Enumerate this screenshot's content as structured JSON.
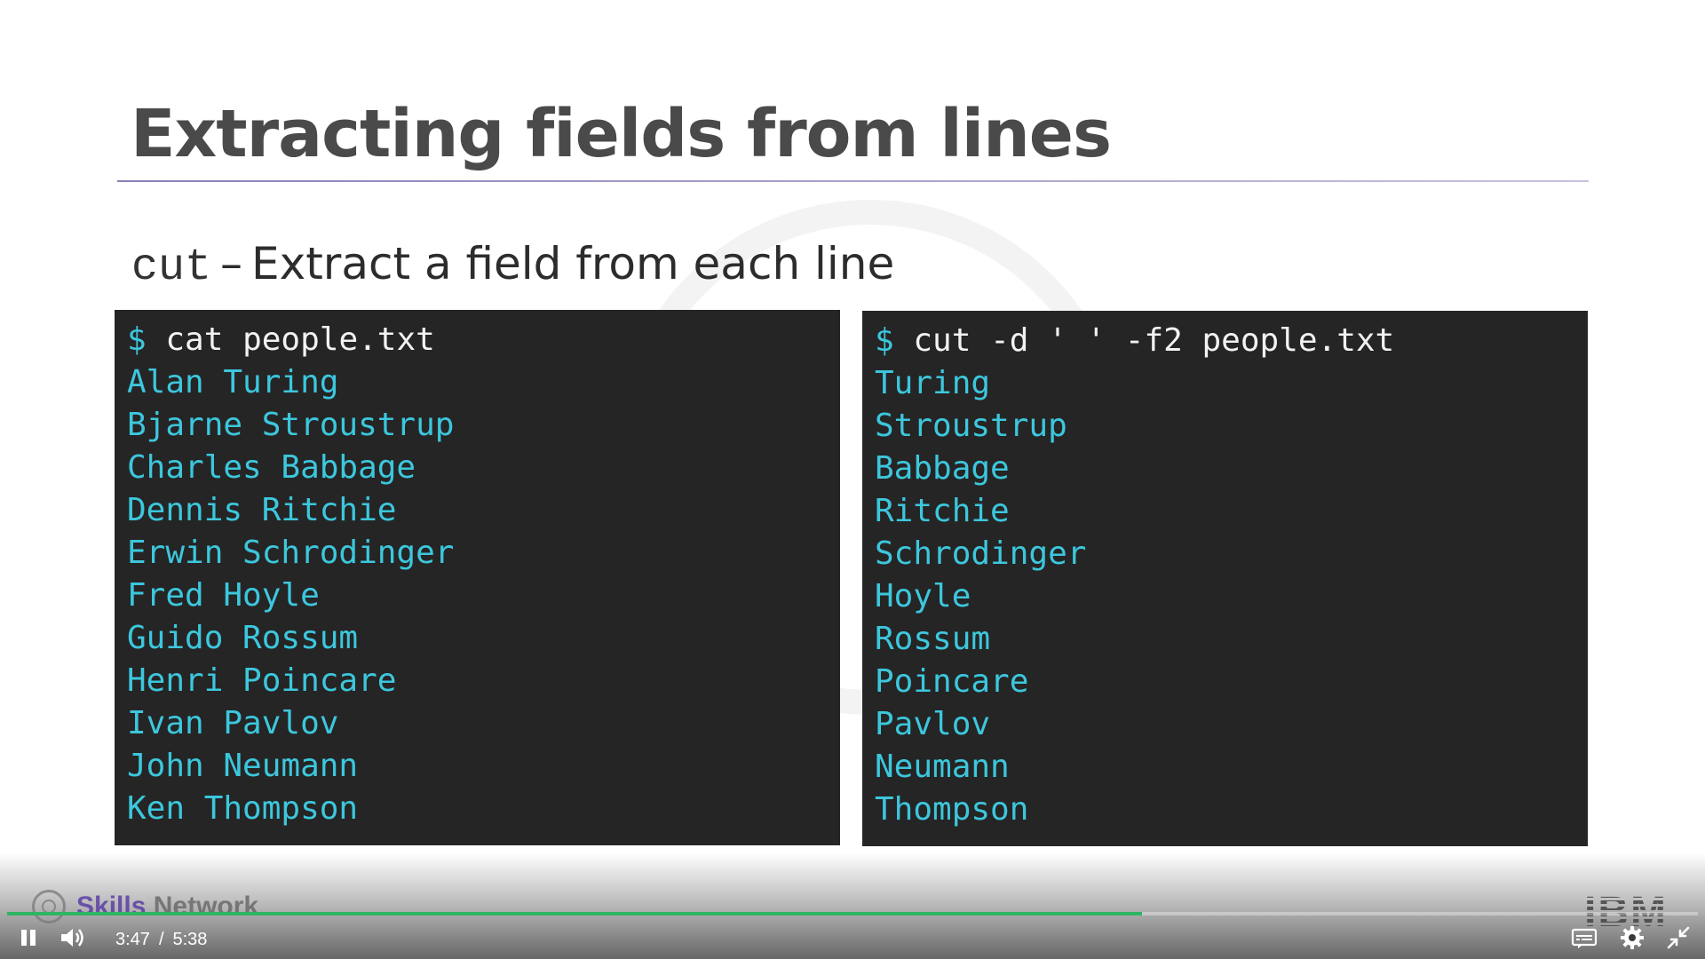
{
  "slide": {
    "title": "Extracting fields from lines",
    "subtitle_command": "cut",
    "subtitle_dash": "–",
    "subtitle_text": "Extract a field from each line"
  },
  "terminal_left": {
    "prompt_symbol": "$",
    "command": "cat people.txt",
    "lines": [
      "Alan Turing",
      "Bjarne Stroustrup",
      "Charles Babbage",
      "Dennis Ritchie",
      "Erwin Schrodinger",
      "Fred Hoyle",
      "Guido Rossum",
      "Henri Poincare",
      "Ivan Pavlov",
      "John Neumann",
      "Ken Thompson"
    ]
  },
  "terminal_right": {
    "prompt_symbol": "$",
    "command": "cut -d ' ' -f2 people.txt",
    "lines": [
      "Turing",
      "Stroustrup",
      "Babbage",
      "Ritchie",
      "Schrodinger",
      "Hoyle",
      "Rossum",
      "Poincare",
      "Pavlov",
      "Neumann",
      "Thompson"
    ]
  },
  "branding": {
    "skills_network_part1": "Skills",
    "skills_network_part2": "Network",
    "ibm": "IBM"
  },
  "player": {
    "current_time": "3:47",
    "time_separator": "/",
    "duration": "5:38",
    "progress_fraction": 0.671,
    "icons": [
      "pause-icon",
      "volume-icon",
      "captions-icon",
      "settings-icon",
      "exit-fullscreen-icon"
    ]
  },
  "colors": {
    "terminal_bg": "#252525",
    "terminal_text": "#3cc7dd",
    "prompt_text": "#f2f2f2",
    "title": "#4a4a4a",
    "progress": "#2fb463",
    "brand": "#5b3fa6"
  }
}
